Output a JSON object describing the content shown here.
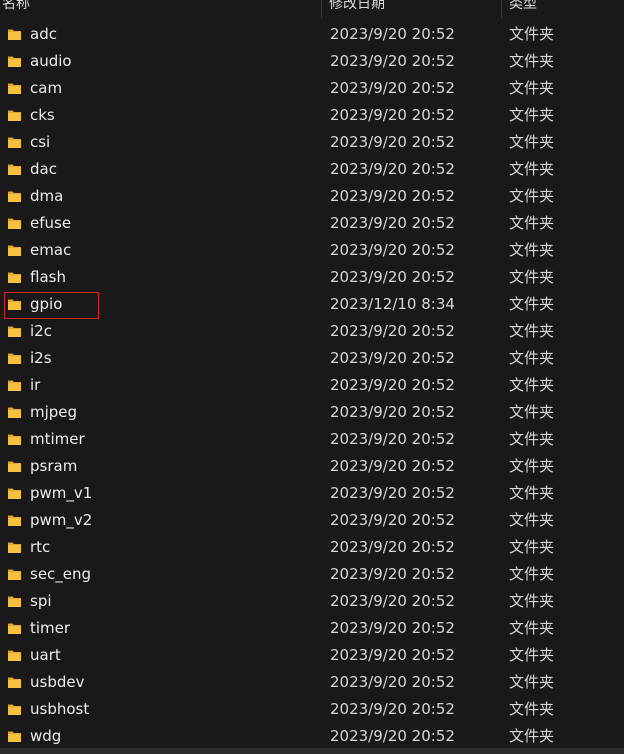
{
  "header": {
    "col_name": "名称",
    "col_date": "修改日期",
    "col_type": "类型"
  },
  "colors": {
    "background": "#191919",
    "folder_yellow": "#f4c240",
    "highlight_red": "#d42a2a"
  },
  "highlighted_item": "gpio",
  "files": [
    {
      "name": "adc",
      "date": "2023/9/20 20:52",
      "type": "文件夹",
      "icon": "folder-icon"
    },
    {
      "name": "audio",
      "date": "2023/9/20 20:52",
      "type": "文件夹",
      "icon": "folder-icon"
    },
    {
      "name": "cam",
      "date": "2023/9/20 20:52",
      "type": "文件夹",
      "icon": "folder-icon"
    },
    {
      "name": "cks",
      "date": "2023/9/20 20:52",
      "type": "文件夹",
      "icon": "folder-icon"
    },
    {
      "name": "csi",
      "date": "2023/9/20 20:52",
      "type": "文件夹",
      "icon": "folder-icon"
    },
    {
      "name": "dac",
      "date": "2023/9/20 20:52",
      "type": "文件夹",
      "icon": "folder-icon"
    },
    {
      "name": "dma",
      "date": "2023/9/20 20:52",
      "type": "文件夹",
      "icon": "folder-icon"
    },
    {
      "name": "efuse",
      "date": "2023/9/20 20:52",
      "type": "文件夹",
      "icon": "folder-icon"
    },
    {
      "name": "emac",
      "date": "2023/9/20 20:52",
      "type": "文件夹",
      "icon": "folder-icon"
    },
    {
      "name": "flash",
      "date": "2023/9/20 20:52",
      "type": "文件夹",
      "icon": "folder-icon"
    },
    {
      "name": "gpio",
      "date": "2023/12/10 8:34",
      "type": "文件夹",
      "icon": "folder-icon"
    },
    {
      "name": "i2c",
      "date": "2023/9/20 20:52",
      "type": "文件夹",
      "icon": "folder-icon"
    },
    {
      "name": "i2s",
      "date": "2023/9/20 20:52",
      "type": "文件夹",
      "icon": "folder-icon"
    },
    {
      "name": "ir",
      "date": "2023/9/20 20:52",
      "type": "文件夹",
      "icon": "folder-icon"
    },
    {
      "name": "mjpeg",
      "date": "2023/9/20 20:52",
      "type": "文件夹",
      "icon": "folder-icon"
    },
    {
      "name": "mtimer",
      "date": "2023/9/20 20:52",
      "type": "文件夹",
      "icon": "folder-icon"
    },
    {
      "name": "psram",
      "date": "2023/9/20 20:52",
      "type": "文件夹",
      "icon": "folder-icon"
    },
    {
      "name": "pwm_v1",
      "date": "2023/9/20 20:52",
      "type": "文件夹",
      "icon": "folder-icon"
    },
    {
      "name": "pwm_v2",
      "date": "2023/9/20 20:52",
      "type": "文件夹",
      "icon": "folder-icon"
    },
    {
      "name": "rtc",
      "date": "2023/9/20 20:52",
      "type": "文件夹",
      "icon": "folder-icon"
    },
    {
      "name": "sec_eng",
      "date": "2023/9/20 20:52",
      "type": "文件夹",
      "icon": "folder-icon"
    },
    {
      "name": "spi",
      "date": "2023/9/20 20:52",
      "type": "文件夹",
      "icon": "folder-icon"
    },
    {
      "name": "timer",
      "date": "2023/9/20 20:52",
      "type": "文件夹",
      "icon": "folder-icon"
    },
    {
      "name": "uart",
      "date": "2023/9/20 20:52",
      "type": "文件夹",
      "icon": "folder-icon"
    },
    {
      "name": "usbdev",
      "date": "2023/9/20 20:52",
      "type": "文件夹",
      "icon": "folder-icon"
    },
    {
      "name": "usbhost",
      "date": "2023/9/20 20:52",
      "type": "文件夹",
      "icon": "folder-icon"
    },
    {
      "name": "wdg",
      "date": "2023/9/20 20:52",
      "type": "文件夹",
      "icon": "folder-icon"
    }
  ]
}
